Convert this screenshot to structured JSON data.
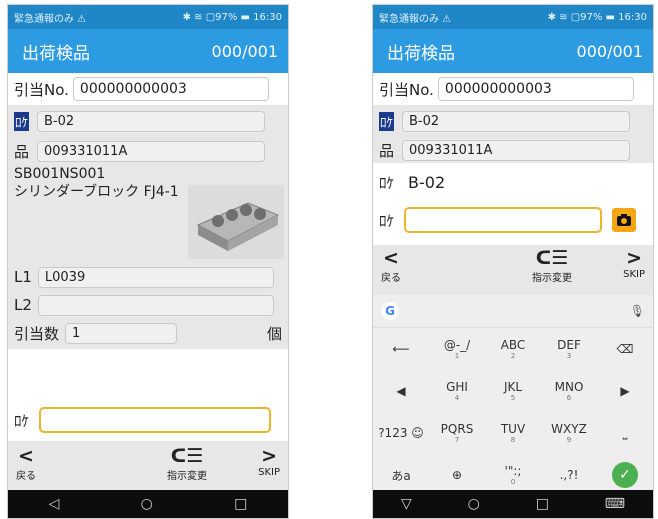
{
  "left": {
    "status": {
      "left": "緊急通報のみ ⚠",
      "right": "✱ ≋ ▢97% ▬ 16:30"
    },
    "appbar": {
      "title": "出荷検品",
      "count": "000/001"
    },
    "hikiate": {
      "label": "引当No.",
      "value": "000000000003"
    },
    "loc": {
      "label": "ﾛｹ",
      "value": "B-02"
    },
    "hin": {
      "label": "品",
      "value": "009331011A"
    },
    "code": "SB001NS001",
    "name": "シリンダーブロック FJ4-1",
    "l1": {
      "label": "L1",
      "value": "L0039"
    },
    "l2": {
      "label": "L2",
      "value": ""
    },
    "qty": {
      "label": "引当数",
      "value": "1",
      "unit": "個"
    },
    "scan": {
      "label": "ﾛｹ",
      "value": ""
    },
    "nav": {
      "back_icon": "<",
      "back": "戻る",
      "change_icon": "ᑕ☰",
      "change": "指示変更",
      "skip_icon": ">",
      "skip": "SKIP"
    },
    "sysnav": {
      "back": "◁",
      "home": "○",
      "recent": "□"
    }
  },
  "right": {
    "status": {
      "left": "緊急通報のみ ⚠",
      "right": "✱ ≋ ▢97% ▬ 16:30"
    },
    "appbar": {
      "title": "出荷検品",
      "count": "000/001"
    },
    "hikiate": {
      "label": "引当No.",
      "value": "000000000003"
    },
    "loc": {
      "label": "ﾛｹ",
      "value": "B-02"
    },
    "hin": {
      "label": "品",
      "value": "009331011A"
    },
    "loc2": {
      "label": "ﾛｹ",
      "value": "B-02"
    },
    "scan": {
      "label": "ﾛｹ",
      "value": ""
    },
    "nav": {
      "back_icon": "<",
      "back": "戻る",
      "change_icon": "ᑕ☰",
      "change": "指示変更",
      "skip_icon": ">",
      "skip": "SKIP"
    },
    "keyboard": {
      "google": "G",
      "mic": "🎙",
      "rows": [
        [
          {
            "t": "⟵",
            "s": ""
          },
          {
            "t": "@-_/",
            "s": "1"
          },
          {
            "t": "ABC",
            "s": "2"
          },
          {
            "t": "DEF",
            "s": "3"
          },
          {
            "t": "⌫",
            "s": ""
          }
        ],
        [
          {
            "t": "◀",
            "s": ""
          },
          {
            "t": "GHI",
            "s": "4"
          },
          {
            "t": "JKL",
            "s": "5"
          },
          {
            "t": "MNO",
            "s": "6"
          },
          {
            "t": "▶",
            "s": ""
          }
        ],
        [
          {
            "t": "?123 ☺",
            "s": ""
          },
          {
            "t": "PQRS",
            "s": "7"
          },
          {
            "t": "TUV",
            "s": "8"
          },
          {
            "t": "WXYZ",
            "s": "9"
          },
          {
            "t": "⎵",
            "s": ""
          }
        ],
        [
          {
            "t": "あa",
            "s": ""
          },
          {
            "t": "⊕",
            "s": ""
          },
          {
            "t": "'\":;",
            "s": "0"
          },
          {
            "t": ".,?!",
            "s": ""
          },
          {
            "t": "✓",
            "s": ""
          }
        ]
      ]
    },
    "sysnav": {
      "back": "▽",
      "home": "○",
      "recent": "□",
      "kb": "⌨"
    }
  }
}
